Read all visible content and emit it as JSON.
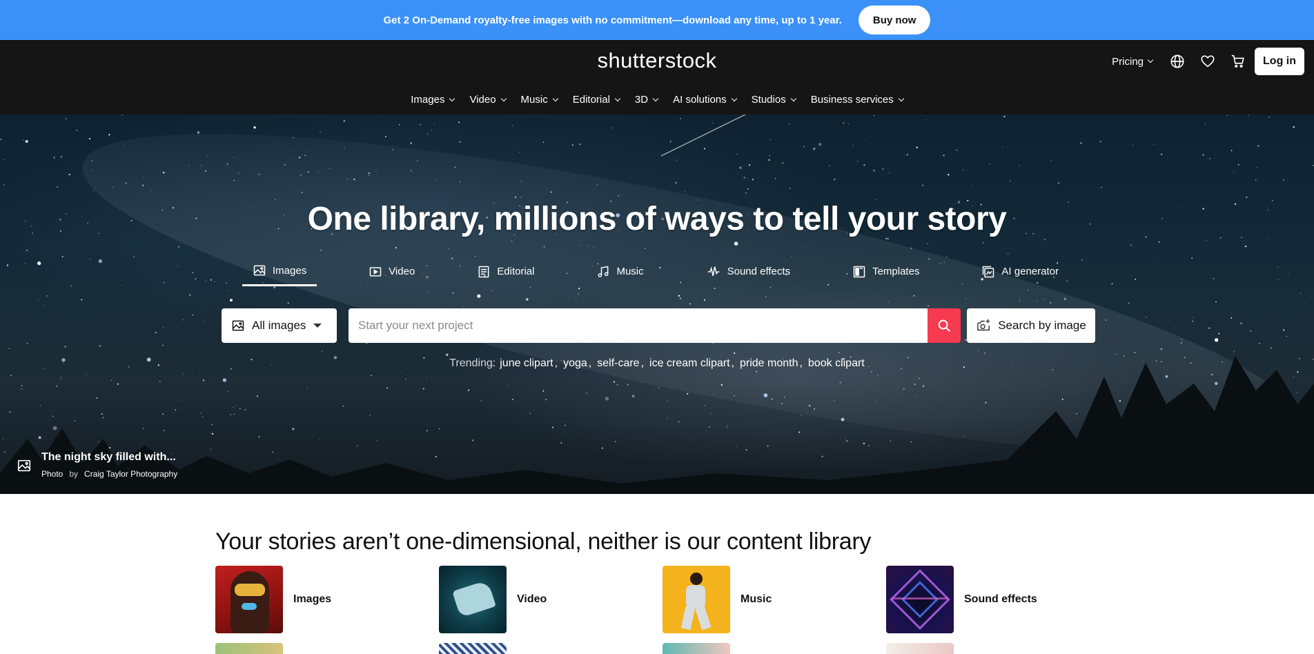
{
  "promo": {
    "text": "Get 2 On-Demand royalty-free images with no commitment—download any time, up to 1 year.",
    "button": "Buy now"
  },
  "header": {
    "logo": "shutterstock",
    "pricing": "Pricing",
    "login": "Log in",
    "nav": [
      "Images",
      "Video",
      "Music",
      "Editorial",
      "3D",
      "AI solutions",
      "Studios",
      "Business services"
    ]
  },
  "hero": {
    "title": "One library, millions of ways to tell your story",
    "tabs": [
      "Images",
      "Video",
      "Editorial",
      "Music",
      "Sound effects",
      "Templates",
      "AI generator"
    ],
    "active_tab": "Images",
    "search": {
      "type": "All images",
      "placeholder": "Start your next project",
      "by_image": "Search by image"
    },
    "trending_label": "Trending:",
    "trending": [
      "june clipart",
      "yoga",
      "self-care",
      "ice cream clipart",
      "pride month",
      "book clipart"
    ],
    "credit": {
      "title": "The night sky filled with...",
      "type": "Photo",
      "by": "by",
      "author": "Craig Taylor Photography"
    }
  },
  "content": {
    "title": "Your stories aren’t one-dimensional, neither is our content library",
    "categories": [
      "Images",
      "Video",
      "Music",
      "Sound effects"
    ]
  },
  "colors": {
    "promo_bg": "#3b91f7",
    "header_bg": "#151515",
    "search_accent": "#f63a4f"
  }
}
